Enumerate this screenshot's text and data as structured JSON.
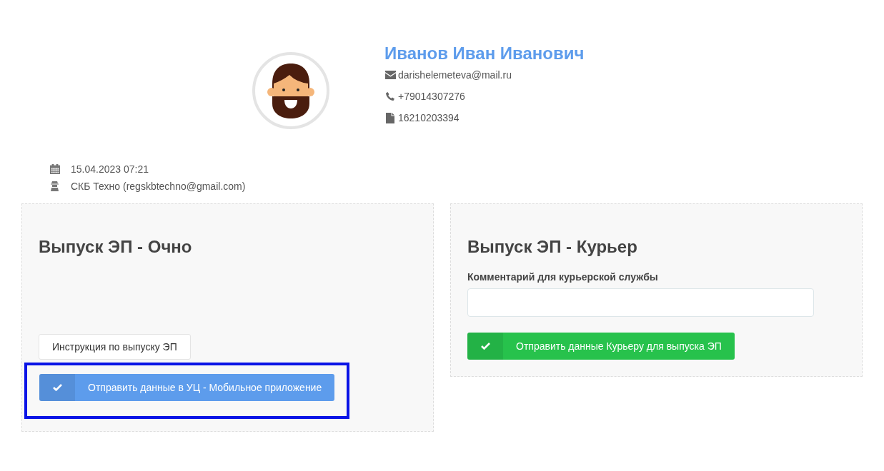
{
  "profile": {
    "name": "Иванов Иван Иванович",
    "contacts": [
      {
        "kind": "email",
        "text": "darishelemeteva@mail.ru"
      },
      {
        "kind": "phone",
        "text": "+79014307276"
      },
      {
        "kind": "document",
        "text": "16210203394"
      }
    ]
  },
  "meta": [
    {
      "kind": "date",
      "text": "15.04.2023 07:21"
    },
    {
      "kind": "agent",
      "text": "СКБ Техно (regskbtechno@gmail.com)"
    }
  ],
  "cards": [
    {
      "title": "Выпуск ЭП - Очно",
      "secondary_button": "Инструкция по выпуску ЭП",
      "primary_button": {
        "label": "Отправить данные в УЦ - Мобильное приложение",
        "color": "#5d9cec",
        "highlighted": true
      }
    },
    {
      "title": "Выпуск ЭП - Курьер",
      "field": {
        "label": "Комментарий для курьерской службы"
      },
      "primary_button": {
        "label": "Отправить данные Курьеру для выпуска ЭП",
        "color": "#27c24c",
        "highlighted": false
      }
    }
  ]
}
